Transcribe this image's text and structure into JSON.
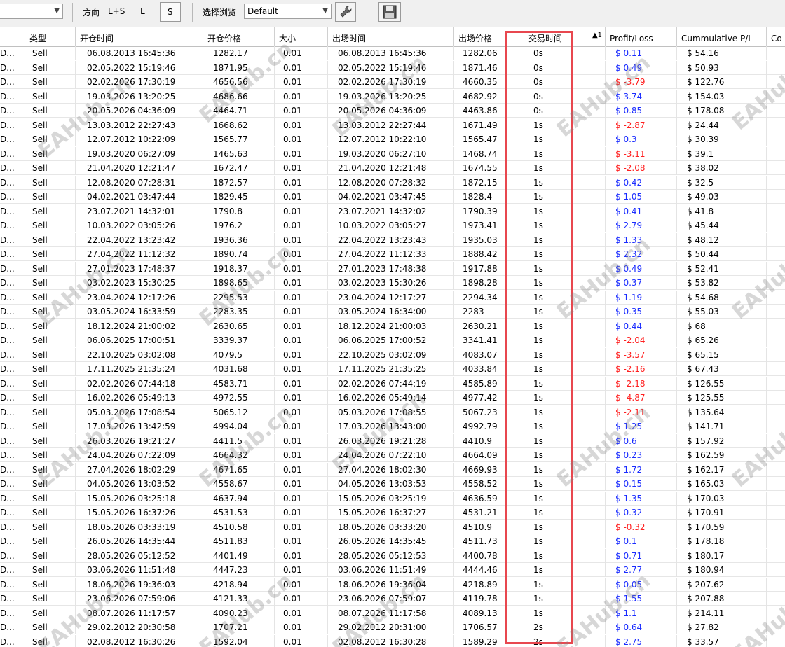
{
  "toolbar": {
    "first_select_value": "",
    "direction_label": "方向",
    "direction_options": [
      "L+S",
      "L",
      "S"
    ],
    "browse_label": "选择浏览",
    "browse_value": "Default",
    "tool_icon": "wrench-icon",
    "save_icon": "floppy-disk-icon"
  },
  "columns": {
    "symbol": "",
    "type": "类型",
    "open_time": "开仓时间",
    "open_price": "开仓价格",
    "size": "大小",
    "exit_time": "出场时间",
    "exit_price": "出场价格",
    "duration": "交易时间",
    "sort_indicator": "▲1",
    "profit": "Profit/Loss",
    "cumulative": "Cummulative P/L",
    "extra": "Co"
  },
  "accent": {
    "highlight": "#e8474f",
    "negative": "#ff2020",
    "positive": "#1a2cff"
  },
  "watermark_text": "EAHub.cn",
  "rows": [
    {
      "symbol": "D...",
      "type": "Sell",
      "open_time": "06.08.2013 16:45:36",
      "open_price": "1282.17",
      "size": "0.01",
      "exit_time": "06.08.2013 16:45:36",
      "exit_price": "1282.06",
      "duration": "0s",
      "profit": "$ 0.11",
      "cum": "$ 54.16",
      "neg": false
    },
    {
      "symbol": "D...",
      "type": "Sell",
      "open_time": "02.05.2022 15:19:46",
      "open_price": "1871.95",
      "size": "0.01",
      "exit_time": "02.05.2022 15:19:46",
      "exit_price": "1871.46",
      "duration": "0s",
      "profit": "$ 0.49",
      "cum": "$ 50.93",
      "neg": false
    },
    {
      "symbol": "D...",
      "type": "Sell",
      "open_time": "02.02.2026 17:30:19",
      "open_price": "4656.56",
      "size": "0.01",
      "exit_time": "02.02.2026 17:30:19",
      "exit_price": "4660.35",
      "duration": "0s",
      "profit": "$ -3.79",
      "cum": "$ 122.76",
      "neg": true
    },
    {
      "symbol": "D...",
      "type": "Sell",
      "open_time": "19.03.2026 13:20:25",
      "open_price": "4686.66",
      "size": "0.01",
      "exit_time": "19.03.2026 13:20:25",
      "exit_price": "4682.92",
      "duration": "0s",
      "profit": "$ 3.74",
      "cum": "$ 154.03",
      "neg": false
    },
    {
      "symbol": "D...",
      "type": "Sell",
      "open_time": "20.05.2026 04:36:09",
      "open_price": "4464.71",
      "size": "0.01",
      "exit_time": "20.05.2026 04:36:09",
      "exit_price": "4463.86",
      "duration": "0s",
      "profit": "$ 0.85",
      "cum": "$ 178.08",
      "neg": false
    },
    {
      "symbol": "D...",
      "type": "Sell",
      "open_time": "13.03.2012 22:27:43",
      "open_price": "1668.62",
      "size": "0.01",
      "exit_time": "13.03.2012 22:27:44",
      "exit_price": "1671.49",
      "duration": "1s",
      "profit": "$ -2.87",
      "cum": "$ 24.44",
      "neg": true
    },
    {
      "symbol": "D...",
      "type": "Sell",
      "open_time": "12.07.2012 10:22:09",
      "open_price": "1565.77",
      "size": "0.01",
      "exit_time": "12.07.2012 10:22:10",
      "exit_price": "1565.47",
      "duration": "1s",
      "profit": "$ 0.3",
      "cum": "$ 30.39",
      "neg": false
    },
    {
      "symbol": "D...",
      "type": "Sell",
      "open_time": "19.03.2020 06:27:09",
      "open_price": "1465.63",
      "size": "0.01",
      "exit_time": "19.03.2020 06:27:10",
      "exit_price": "1468.74",
      "duration": "1s",
      "profit": "$ -3.11",
      "cum": "$ 39.1",
      "neg": true
    },
    {
      "symbol": "D...",
      "type": "Sell",
      "open_time": "21.04.2020 12:21:47",
      "open_price": "1672.47",
      "size": "0.01",
      "exit_time": "21.04.2020 12:21:48",
      "exit_price": "1674.55",
      "duration": "1s",
      "profit": "$ -2.08",
      "cum": "$ 38.02",
      "neg": true
    },
    {
      "symbol": "D...",
      "type": "Sell",
      "open_time": "12.08.2020 07:28:31",
      "open_price": "1872.57",
      "size": "0.01",
      "exit_time": "12.08.2020 07:28:32",
      "exit_price": "1872.15",
      "duration": "1s",
      "profit": "$ 0.42",
      "cum": "$ 32.5",
      "neg": false
    },
    {
      "symbol": "D...",
      "type": "Sell",
      "open_time": "04.02.2021 03:47:44",
      "open_price": "1829.45",
      "size": "0.01",
      "exit_time": "04.02.2021 03:47:45",
      "exit_price": "1828.4",
      "duration": "1s",
      "profit": "$ 1.05",
      "cum": "$ 49.03",
      "neg": false
    },
    {
      "symbol": "D...",
      "type": "Sell",
      "open_time": "23.07.2021 14:32:01",
      "open_price": "1790.8",
      "size": "0.01",
      "exit_time": "23.07.2021 14:32:02",
      "exit_price": "1790.39",
      "duration": "1s",
      "profit": "$ 0.41",
      "cum": "$ 41.8",
      "neg": false
    },
    {
      "symbol": "D...",
      "type": "Sell",
      "open_time": "10.03.2022 03:05:26",
      "open_price": "1976.2",
      "size": "0.01",
      "exit_time": "10.03.2022 03:05:27",
      "exit_price": "1973.41",
      "duration": "1s",
      "profit": "$ 2.79",
      "cum": "$ 45.44",
      "neg": false
    },
    {
      "symbol": "D...",
      "type": "Sell",
      "open_time": "22.04.2022 13:23:42",
      "open_price": "1936.36",
      "size": "0.01",
      "exit_time": "22.04.2022 13:23:43",
      "exit_price": "1935.03",
      "duration": "1s",
      "profit": "$ 1.33",
      "cum": "$ 48.12",
      "neg": false
    },
    {
      "symbol": "D...",
      "type": "Sell",
      "open_time": "27.04.2022 11:12:32",
      "open_price": "1890.74",
      "size": "0.01",
      "exit_time": "27.04.2022 11:12:33",
      "exit_price": "1888.42",
      "duration": "1s",
      "profit": "$ 2.32",
      "cum": "$ 50.44",
      "neg": false
    },
    {
      "symbol": "D...",
      "type": "Sell",
      "open_time": "27.01.2023 17:48:37",
      "open_price": "1918.37",
      "size": "0.01",
      "exit_time": "27.01.2023 17:48:38",
      "exit_price": "1917.88",
      "duration": "1s",
      "profit": "$ 0.49",
      "cum": "$ 52.41",
      "neg": false
    },
    {
      "symbol": "D...",
      "type": "Sell",
      "open_time": "03.02.2023 15:30:25",
      "open_price": "1898.65",
      "size": "0.01",
      "exit_time": "03.02.2023 15:30:26",
      "exit_price": "1898.28",
      "duration": "1s",
      "profit": "$ 0.37",
      "cum": "$ 53.82",
      "neg": false
    },
    {
      "symbol": "D...",
      "type": "Sell",
      "open_time": "23.04.2024 12:17:26",
      "open_price": "2295.53",
      "size": "0.01",
      "exit_time": "23.04.2024 12:17:27",
      "exit_price": "2294.34",
      "duration": "1s",
      "profit": "$ 1.19",
      "cum": "$ 54.68",
      "neg": false
    },
    {
      "symbol": "D...",
      "type": "Sell",
      "open_time": "03.05.2024 16:33:59",
      "open_price": "2283.35",
      "size": "0.01",
      "exit_time": "03.05.2024 16:34:00",
      "exit_price": "2283",
      "duration": "1s",
      "profit": "$ 0.35",
      "cum": "$ 55.03",
      "neg": false
    },
    {
      "symbol": "D...",
      "type": "Sell",
      "open_time": "18.12.2024 21:00:02",
      "open_price": "2630.65",
      "size": "0.01",
      "exit_time": "18.12.2024 21:00:03",
      "exit_price": "2630.21",
      "duration": "1s",
      "profit": "$ 0.44",
      "cum": "$ 68",
      "neg": false
    },
    {
      "symbol": "D...",
      "type": "Sell",
      "open_time": "06.06.2025 17:00:51",
      "open_price": "3339.37",
      "size": "0.01",
      "exit_time": "06.06.2025 17:00:52",
      "exit_price": "3341.41",
      "duration": "1s",
      "profit": "$ -2.04",
      "cum": "$ 65.26",
      "neg": true
    },
    {
      "symbol": "D...",
      "type": "Sell",
      "open_time": "22.10.2025 03:02:08",
      "open_price": "4079.5",
      "size": "0.01",
      "exit_time": "22.10.2025 03:02:09",
      "exit_price": "4083.07",
      "duration": "1s",
      "profit": "$ -3.57",
      "cum": "$ 65.15",
      "neg": true
    },
    {
      "symbol": "D...",
      "type": "Sell",
      "open_time": "17.11.2025 21:35:24",
      "open_price": "4031.68",
      "size": "0.01",
      "exit_time": "17.11.2025 21:35:25",
      "exit_price": "4033.84",
      "duration": "1s",
      "profit": "$ -2.16",
      "cum": "$ 67.43",
      "neg": true
    },
    {
      "symbol": "D...",
      "type": "Sell",
      "open_time": "02.02.2026 07:44:18",
      "open_price": "4583.71",
      "size": "0.01",
      "exit_time": "02.02.2026 07:44:19",
      "exit_price": "4585.89",
      "duration": "1s",
      "profit": "$ -2.18",
      "cum": "$ 126.55",
      "neg": true
    },
    {
      "symbol": "D...",
      "type": "Sell",
      "open_time": "16.02.2026 05:49:13",
      "open_price": "4972.55",
      "size": "0.01",
      "exit_time": "16.02.2026 05:49:14",
      "exit_price": "4977.42",
      "duration": "1s",
      "profit": "$ -4.87",
      "cum": "$ 125.55",
      "neg": true
    },
    {
      "symbol": "D...",
      "type": "Sell",
      "open_time": "05.03.2026 17:08:54",
      "open_price": "5065.12",
      "size": "0.01",
      "exit_time": "05.03.2026 17:08:55",
      "exit_price": "5067.23",
      "duration": "1s",
      "profit": "$ -2.11",
      "cum": "$ 135.64",
      "neg": true
    },
    {
      "symbol": "D...",
      "type": "Sell",
      "open_time": "17.03.2026 13:42:59",
      "open_price": "4994.04",
      "size": "0.01",
      "exit_time": "17.03.2026 13:43:00",
      "exit_price": "4992.79",
      "duration": "1s",
      "profit": "$ 1.25",
      "cum": "$ 141.71",
      "neg": false
    },
    {
      "symbol": "D...",
      "type": "Sell",
      "open_time": "26.03.2026 19:21:27",
      "open_price": "4411.5",
      "size": "0.01",
      "exit_time": "26.03.2026 19:21:28",
      "exit_price": "4410.9",
      "duration": "1s",
      "profit": "$ 0.6",
      "cum": "$ 157.92",
      "neg": false
    },
    {
      "symbol": "D...",
      "type": "Sell",
      "open_time": "24.04.2026 07:22:09",
      "open_price": "4664.32",
      "size": "0.01",
      "exit_time": "24.04.2026 07:22:10",
      "exit_price": "4664.09",
      "duration": "1s",
      "profit": "$ 0.23",
      "cum": "$ 162.59",
      "neg": false
    },
    {
      "symbol": "D...",
      "type": "Sell",
      "open_time": "27.04.2026 18:02:29",
      "open_price": "4671.65",
      "size": "0.01",
      "exit_time": "27.04.2026 18:02:30",
      "exit_price": "4669.93",
      "duration": "1s",
      "profit": "$ 1.72",
      "cum": "$ 162.17",
      "neg": false
    },
    {
      "symbol": "D...",
      "type": "Sell",
      "open_time": "04.05.2026 13:03:52",
      "open_price": "4558.67",
      "size": "0.01",
      "exit_time": "04.05.2026 13:03:53",
      "exit_price": "4558.52",
      "duration": "1s",
      "profit": "$ 0.15",
      "cum": "$ 165.03",
      "neg": false
    },
    {
      "symbol": "D...",
      "type": "Sell",
      "open_time": "15.05.2026 03:25:18",
      "open_price": "4637.94",
      "size": "0.01",
      "exit_time": "15.05.2026 03:25:19",
      "exit_price": "4636.59",
      "duration": "1s",
      "profit": "$ 1.35",
      "cum": "$ 170.03",
      "neg": false
    },
    {
      "symbol": "D...",
      "type": "Sell",
      "open_time": "15.05.2026 16:37:26",
      "open_price": "4531.53",
      "size": "0.01",
      "exit_time": "15.05.2026 16:37:27",
      "exit_price": "4531.21",
      "duration": "1s",
      "profit": "$ 0.32",
      "cum": "$ 170.91",
      "neg": false
    },
    {
      "symbol": "D...",
      "type": "Sell",
      "open_time": "18.05.2026 03:33:19",
      "open_price": "4510.58",
      "size": "0.01",
      "exit_time": "18.05.2026 03:33:20",
      "exit_price": "4510.9",
      "duration": "1s",
      "profit": "$ -0.32",
      "cum": "$ 170.59",
      "neg": true
    },
    {
      "symbol": "D...",
      "type": "Sell",
      "open_time": "26.05.2026 14:35:44",
      "open_price": "4511.83",
      "size": "0.01",
      "exit_time": "26.05.2026 14:35:45",
      "exit_price": "4511.73",
      "duration": "1s",
      "profit": "$ 0.1",
      "cum": "$ 178.18",
      "neg": false
    },
    {
      "symbol": "D...",
      "type": "Sell",
      "open_time": "28.05.2026 05:12:52",
      "open_price": "4401.49",
      "size": "0.01",
      "exit_time": "28.05.2026 05:12:53",
      "exit_price": "4400.78",
      "duration": "1s",
      "profit": "$ 0.71",
      "cum": "$ 180.17",
      "neg": false
    },
    {
      "symbol": "D...",
      "type": "Sell",
      "open_time": "03.06.2026 11:51:48",
      "open_price": "4447.23",
      "size": "0.01",
      "exit_time": "03.06.2026 11:51:49",
      "exit_price": "4444.46",
      "duration": "1s",
      "profit": "$ 2.77",
      "cum": "$ 180.94",
      "neg": false
    },
    {
      "symbol": "D...",
      "type": "Sell",
      "open_time": "18.06.2026 19:36:03",
      "open_price": "4218.94",
      "size": "0.01",
      "exit_time": "18.06.2026 19:36:04",
      "exit_price": "4218.89",
      "duration": "1s",
      "profit": "$ 0.05",
      "cum": "$ 207.62",
      "neg": false
    },
    {
      "symbol": "D...",
      "type": "Sell",
      "open_time": "23.06.2026 07:59:06",
      "open_price": "4121.33",
      "size": "0.01",
      "exit_time": "23.06.2026 07:59:07",
      "exit_price": "4119.78",
      "duration": "1s",
      "profit": "$ 1.55",
      "cum": "$ 207.88",
      "neg": false
    },
    {
      "symbol": "D...",
      "type": "Sell",
      "open_time": "08.07.2026 11:17:57",
      "open_price": "4090.23",
      "size": "0.01",
      "exit_time": "08.07.2026 11:17:58",
      "exit_price": "4089.13",
      "duration": "1s",
      "profit": "$ 1.1",
      "cum": "$ 214.11",
      "neg": false
    },
    {
      "symbol": "D...",
      "type": "Sell",
      "open_time": "29.02.2012 20:30:58",
      "open_price": "1707.21",
      "size": "0.01",
      "exit_time": "29.02.2012 20:31:00",
      "exit_price": "1706.57",
      "duration": "2s",
      "profit": "$ 0.64",
      "cum": "$ 27.82",
      "neg": false
    },
    {
      "symbol": "D...",
      "type": "Sell",
      "open_time": "02.08.2012 16:30:26",
      "open_price": "1592.04",
      "size": "0.01",
      "exit_time": "02.08.2012 16:30:28",
      "exit_price": "1589.29",
      "duration": "2s",
      "profit": "$ 2.75",
      "cum": "$ 33.57",
      "neg": false
    }
  ]
}
